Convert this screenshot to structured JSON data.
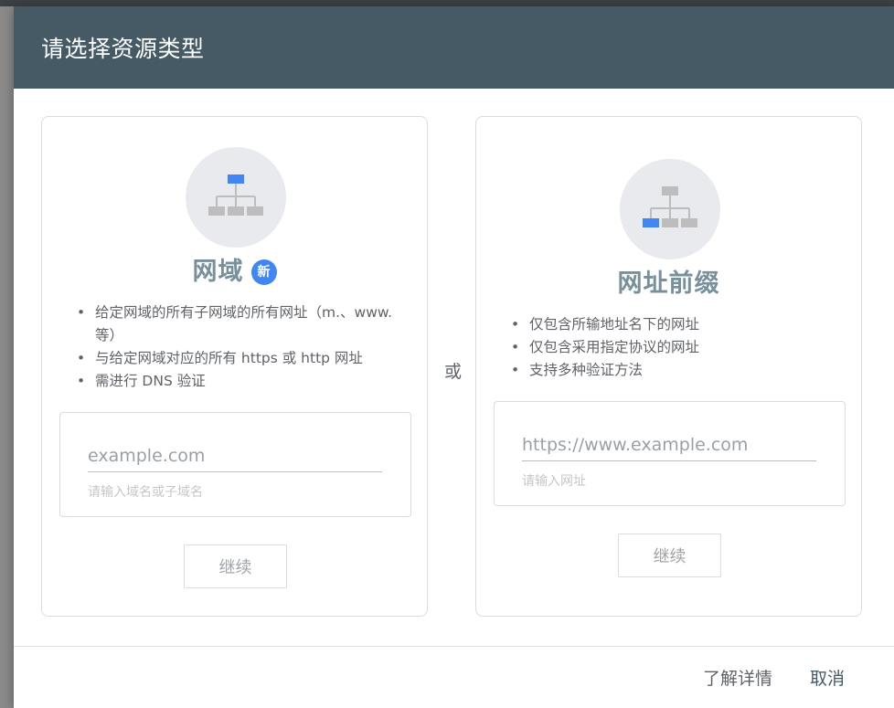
{
  "dialog": {
    "title": "请选择资源类型",
    "or_label": "或"
  },
  "domain": {
    "title": "网域",
    "badge": "新",
    "bullets": [
      "给定网域的所有子网域的所有网址（m.、www. 等）",
      "与给定网域对应的所有 https 或 http 网址",
      "需进行 DNS 验证"
    ],
    "input_placeholder": "example.com",
    "input_value": "",
    "input_hint": "请输入域名或子域名",
    "continue_label": "继续",
    "icon": "sitemap-icon",
    "highlight_color": "#4285f4"
  },
  "prefix": {
    "title": "网址前缀",
    "bullets": [
      "仅包含所输地址名下的网址",
      "仅包含采用指定协议的网址",
      "支持多种验证方法"
    ],
    "input_placeholder": "https://www.example.com",
    "input_value": "",
    "input_hint": "请输入网址",
    "continue_label": "继续",
    "icon": "sitemap-icon",
    "highlight_color": "#4285f4"
  },
  "footer": {
    "learn_more_label": "了解详情",
    "cancel_label": "取消"
  },
  "colors": {
    "header_bg": "#455a64",
    "card_title": "#78909c",
    "icon_gray": "#bdbdbd",
    "accent": "#4285f4"
  }
}
